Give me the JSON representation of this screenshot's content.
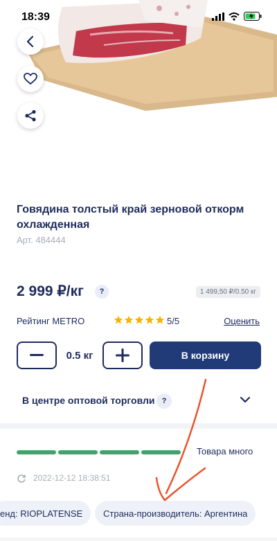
{
  "status_bar": {
    "time": "18:39"
  },
  "product": {
    "title": "Говядина толстый край зерновой откорм охлажденная",
    "article": "Арт. 484444",
    "price": "2 999 ₽/кг",
    "help": "?",
    "unit_price": "1 499,50 ₽/0.50 кг"
  },
  "rating": {
    "label": "Рейтинг METRO",
    "value": "5/5",
    "stars": 5,
    "rate_link": "Оценить"
  },
  "quantity": {
    "value": "0.5 кг"
  },
  "cart": {
    "label": "В корзину"
  },
  "availability": {
    "label": "В центре оптовой торговли",
    "help": "?"
  },
  "stock": {
    "label": "Товара много",
    "level": 1.0
  },
  "update": {
    "timestamp": "2022-12-12 18:38:51"
  },
  "chips": [
    "енд: RIOPLATENSE",
    "Страна-производитель: Аргентина"
  ],
  "colors": {
    "primary": "#213a78",
    "text": "#1d2b5c",
    "stock": "#3fa36a",
    "arrow": "#e8532c"
  },
  "icons": [
    "back-icon",
    "heart-icon",
    "share-icon",
    "minus-icon",
    "plus-icon",
    "chevron-down-icon",
    "refresh-icon",
    "star-icon"
  ]
}
